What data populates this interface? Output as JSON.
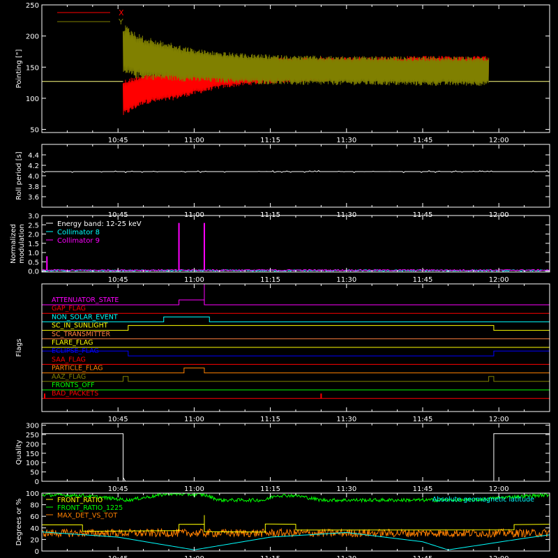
{
  "chart_data": [
    {
      "type": "line",
      "ylabel": "Pointing [\"]",
      "ylim": [
        45,
        250
      ],
      "yticks": [
        "50",
        "100",
        "150",
        "200",
        "250"
      ],
      "x_range": [
        "10:30",
        "12:10"
      ],
      "xticks": [
        "10:45",
        "11:00",
        "11:15",
        "11:30",
        "11:45",
        "12:00"
      ],
      "baseline_value": 127,
      "series": [
        {
          "name": "X",
          "color": "#ff0000",
          "envelope": {
            "time": [
              "10:46",
              "10:50",
              "10:55",
              "11:00",
              "11:05",
              "11:10",
              "11:15",
              "11:20",
              "11:30",
              "11:45",
              "11:58"
            ],
            "low": [
              70,
              90,
              95,
              105,
              115,
              120,
              123,
              126,
              128,
              130,
              130
            ],
            "high": [
              130,
              140,
              145,
              152,
              158,
              162,
              165,
              166,
              167,
              168,
              168
            ]
          }
        },
        {
          "name": "Y",
          "color": "#808000",
          "envelope": {
            "time": [
              "10:46",
              "10:50",
              "10:55",
              "11:00",
              "11:05",
              "11:10",
              "11:15",
              "11:20",
              "11:30",
              "11:45",
              "11:58"
            ],
            "low": [
              135,
              130,
              128,
              126,
              125,
              123,
              122,
              121,
              121,
              120,
              120
            ],
            "high": [
              220,
              200,
              190,
              180,
              175,
              172,
              170,
              169,
              168,
              167,
              167
            ]
          }
        }
      ]
    },
    {
      "type": "line",
      "ylabel": "Roll period [s]",
      "ylim": [
        3.4,
        4.6
      ],
      "yticks": [
        "3.6",
        "3.8",
        "4.0",
        "4.2",
        "4.4"
      ],
      "xticks": [
        "10:45",
        "11:00",
        "11:15",
        "11:30",
        "11:45",
        "12:00"
      ],
      "series": [
        {
          "color": "#ffffff",
          "value": 4.08
        }
      ]
    },
    {
      "type": "line",
      "ylabel_lines": [
        "Normalized",
        "modulation"
      ],
      "ylim": [
        -0.05,
        3.0
      ],
      "yticks": [
        "0.0",
        "0.5",
        "1.0",
        "1.5",
        "2.0",
        "2.5",
        "3.0"
      ],
      "xticks": [
        "10:45",
        "11:00",
        "11:15",
        "11:30",
        "11:45",
        "12:00"
      ],
      "legend": [
        "Energy band: 12-25 keV",
        "Collimator 8",
        "Collimator 9"
      ],
      "series": [
        {
          "name": "Collimator 8",
          "color": "#00ffff",
          "level": 0.03
        },
        {
          "name": "Collimator 9",
          "color": "#ff00ff",
          "level": 0.05,
          "spikes": [
            {
              "time": "10:31",
              "value": 0.8
            },
            {
              "time": "10:57",
              "value": 2.6
            },
            {
              "time": "11:02",
              "value": 2.6
            }
          ]
        }
      ]
    },
    {
      "type": "line",
      "ylabel": "Flags",
      "xticks": [
        "10:45",
        "11:00",
        "11:15",
        "11:30",
        "11:45",
        "12:00"
      ],
      "flags": [
        {
          "label": "ATTENUATOR_STATE",
          "color": "#ff00ff",
          "on": [
            [
              "10:57",
              "11:02"
            ]
          ],
          "spike": "11:02"
        },
        {
          "label": "GAP_FLAG",
          "color": "#ff0000",
          "on": []
        },
        {
          "label": "NON_SOLAR_EVENT",
          "color": "#00ffff",
          "on": [
            [
              "10:54",
              "11:03"
            ]
          ]
        },
        {
          "label": "SC_IN_SUNLIGHT",
          "color": "#ffff00",
          "on": [
            [
              "10:47",
              "11:59"
            ]
          ]
        },
        {
          "label": "SC_TRANSMITTER",
          "color": "#ff8040",
          "on": []
        },
        {
          "label": "FLARE_FLAG",
          "color": "#ffff00",
          "on": []
        },
        {
          "label": "ECLIPSE_FLAG",
          "color": "#0000ff",
          "on": [
            [
              "10:30",
              "10:47"
            ],
            [
              "11:59",
              "12:10"
            ]
          ]
        },
        {
          "label": "SAA_FLAG",
          "color": "#ff0000",
          "on": []
        },
        {
          "label": "PARTICLE_FLAG",
          "color": "#ff8000",
          "on": [
            [
              "10:58",
              "11:02"
            ]
          ]
        },
        {
          "label": "AAZ_FLAG",
          "color": "#808000",
          "on": [
            [
              "10:46",
              "10:47"
            ],
            [
              "11:58",
              "11:59"
            ]
          ]
        },
        {
          "label": "FRONTS_OFF",
          "color": "#00ff00",
          "on": []
        },
        {
          "label": "BAD_PACKETS",
          "color": "#ff0000",
          "on": [],
          "spikes": [
            "10:30",
            "11:25"
          ]
        }
      ]
    },
    {
      "type": "line",
      "ylabel": "Quality",
      "ylim": [
        0,
        310
      ],
      "yticks": [
        "0",
        "50",
        "100",
        "150",
        "200",
        "250",
        "300"
      ],
      "xticks": [
        "10:45",
        "11:00",
        "11:15",
        "11:30",
        "11:45",
        "12:00"
      ],
      "series": [
        {
          "color": "#ffffff",
          "segments": [
            {
              "from": "10:30",
              "to": "10:46",
              "value": 255
            },
            {
              "from": "10:46",
              "to": "11:59",
              "value": 0
            },
            {
              "from": "11:59",
              "to": "12:10",
              "value": 255
            }
          ]
        }
      ]
    },
    {
      "type": "line",
      "ylabel": "Degrees or %",
      "ylim": [
        0,
        100
      ],
      "yticks": [
        "0",
        "20",
        "40",
        "60",
        "80",
        "100"
      ],
      "xticks": [
        "10:45",
        "11:00",
        "11:15",
        "11:30",
        "11:45",
        "12:00"
      ],
      "legend": [
        "FRONT_RATIO",
        "FRONT_RATIO_1225",
        "MAX_DET_VS_TOT"
      ],
      "annotation": "Absolute geomagnetic latitude",
      "series": [
        {
          "name": "FRONT_RATIO",
          "color": "#ffff00",
          "points": [
            [
              "10:30",
              45
            ],
            [
              "10:38",
              45
            ],
            [
              "10:38",
              35
            ],
            [
              "10:57",
              35
            ],
            [
              "10:57",
              46
            ],
            [
              "11:02",
              46
            ],
            [
              "11:02",
              33
            ],
            [
              "11:14",
              33
            ],
            [
              "11:14",
              46
            ],
            [
              "11:20",
              46
            ],
            [
              "11:20",
              36
            ],
            [
              "12:03",
              36
            ],
            [
              "12:03",
              46
            ],
            [
              "12:10",
              46
            ]
          ]
        },
        {
          "name": "FRONT_RATIO_1225",
          "color": "#00ff00",
          "points": [
            [
              "10:30",
              97
            ],
            [
              "10:38",
              96
            ],
            [
              "10:47",
              88
            ],
            [
              "10:55",
              99
            ],
            [
              "11:02",
              97
            ],
            [
              "11:05",
              88
            ],
            [
              "11:14",
              88
            ],
            [
              "11:16",
              96
            ],
            [
              "11:20",
              96
            ],
            [
              "11:25",
              88
            ],
            [
              "11:40",
              88
            ],
            [
              "11:55",
              88
            ],
            [
              "12:03",
              94
            ],
            [
              "12:10",
              97
            ]
          ]
        },
        {
          "name": "MAX_DET_VS_TOT",
          "color": "#ff8000",
          "level": 31
        },
        {
          "name": "Absolute geomagnetic latitude",
          "color": "#00ffff",
          "points": [
            [
              "10:30",
              33
            ],
            [
              "10:45",
              24
            ],
            [
              "11:00",
              2
            ],
            [
              "11:15",
              24
            ],
            [
              "11:30",
              32
            ],
            [
              "11:45",
              16
            ],
            [
              "11:50",
              2
            ],
            [
              "12:05",
              22
            ],
            [
              "12:10",
              28
            ]
          ]
        }
      ]
    }
  ]
}
